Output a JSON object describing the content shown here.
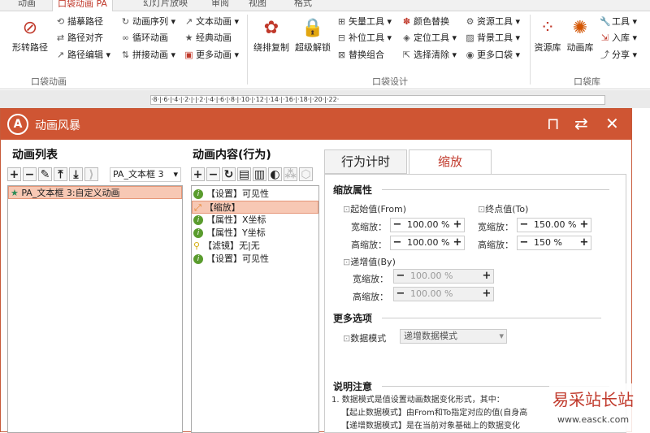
{
  "tabs": [
    "动画",
    "口袋动画 PA",
    "幻灯片放映",
    "审阅",
    "视图",
    "格式"
  ],
  "ribbon": {
    "shape_path": "形转路径",
    "col1": [
      "描摹路径",
      "路径对齐",
      "路径编辑"
    ],
    "col2": [
      "动画序列",
      "循环动画",
      "拼接动画"
    ],
    "col3": [
      "文本动画",
      "经典动画",
      "更多动画"
    ],
    "group1": "口袋动画",
    "copy": "绕排复制",
    "unlock": "超级解锁",
    "col4": [
      "矢量工具",
      "补位工具",
      "替换组合"
    ],
    "col5": [
      "颜色替换",
      "定位工具",
      "选择清除"
    ],
    "col6": [
      "资源工具",
      "背景工具",
      "更多口袋"
    ],
    "group2": "口袋设计",
    "res": "资源库",
    "anim": "动画库",
    "col7": [
      "工具",
      "入库",
      "分享"
    ],
    "group3": "口袋库"
  },
  "ruler": "·8·|·6·|·4·|·2·|·|·2·|·4·|·6·|·8·|·10·|·12·|·14·|·16·|·18·|·20·|·22·",
  "dialog": {
    "title": "动画风暴",
    "list_header": "动画列表",
    "combo": "PA_文本框 3",
    "list_item": "PA_文本框 3:自定义动画",
    "content_header": "动画内容(行为)",
    "content_items": [
      {
        "tag": "【设置】",
        "name": "可见性"
      },
      {
        "tag": "【缩放】",
        "name": ""
      },
      {
        "tag": "【属性】",
        "name": "X坐标"
      },
      {
        "tag": "【属性】",
        "name": "Y坐标"
      },
      {
        "tag": "【滤镜】",
        "name": "无|无"
      },
      {
        "tag": "【设置】",
        "name": "可见性"
      }
    ],
    "tab_timing": "行为计时",
    "tab_scale": "缩放",
    "scale_title": "缩放属性",
    "from_title": "起始值(From)",
    "to_title": "终点值(To)",
    "by_title": "递增值(By)",
    "width_label": "宽缩放：",
    "height_label": "高缩放：",
    "from_w": "100.00 %",
    "from_h": "100.00 %",
    "to_w": "150.00 %",
    "to_h": "150 %",
    "by_w": "100.00 %",
    "by_h": "100.00 %",
    "more_title": "更多选项",
    "data_mode_label": "数据模式",
    "data_mode_value": "递增数据模式",
    "note_title": "说明注意",
    "notes": [
      "1. 数据模式是值设置动画数据变化形式，其中：",
      "【起止数据模式】由From和To指定对应的值(自身高",
      "【递增数据模式】是在当前对象基础上的数据变化"
    ]
  },
  "watermark": {
    "text": "易采站长站",
    "url": "www.easck.com"
  }
}
